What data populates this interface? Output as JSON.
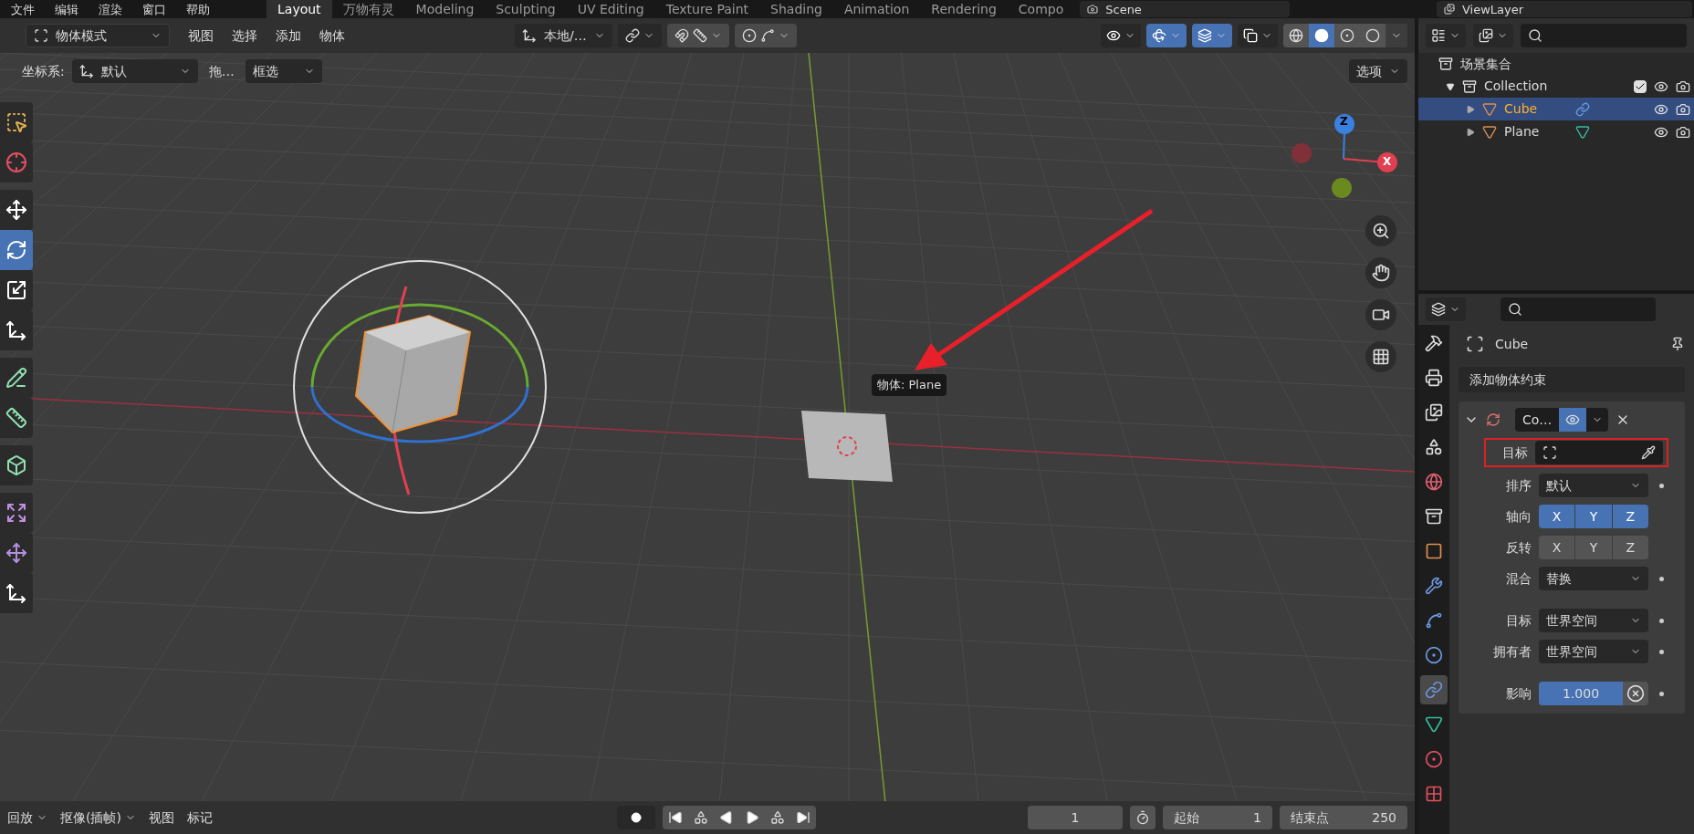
{
  "top_menu": [
    "文件",
    "编辑",
    "渲染",
    "窗口",
    "帮助"
  ],
  "workspace_tabs": [
    {
      "label": "Layout",
      "selected": true
    },
    {
      "label": "万物有灵",
      "selected": false
    },
    {
      "label": "Modeling",
      "selected": false
    },
    {
      "label": "Sculpting",
      "selected": false
    },
    {
      "label": "UV Editing",
      "selected": false
    },
    {
      "label": "Texture Paint",
      "selected": false
    },
    {
      "label": "Shading",
      "selected": false
    },
    {
      "label": "Animation",
      "selected": false
    },
    {
      "label": "Rendering",
      "selected": false
    },
    {
      "label": "Compo",
      "selected": false
    }
  ],
  "scene": "Scene",
  "view_layer": "ViewLayer",
  "header": {
    "mode": "物体模式",
    "menus": [
      "视图",
      "选择",
      "添加",
      "物体"
    ],
    "transform_orientation": "本地/…",
    "toggles": [
      {
        "kind": "visibility",
        "on": false
      },
      {
        "kind": "gizmo",
        "on": true
      },
      {
        "kind": "overlay",
        "on": true
      },
      {
        "kind": "xray",
        "on": false
      }
    ],
    "shading": [
      {
        "kind": "wireframe",
        "selected": false
      },
      {
        "kind": "solid",
        "selected": true
      },
      {
        "kind": "material",
        "selected": false
      },
      {
        "kind": "rendered",
        "selected": false
      }
    ]
  },
  "tool_settings": {
    "coord_label": "坐标系:",
    "coord_value": "默认",
    "drag": "拖…",
    "select_mode": "框选",
    "options": "选项"
  },
  "toolbar": [
    {
      "tools": [
        {
          "kind": "select",
          "selected": false
        },
        {
          "kind": "cursor",
          "selected": false
        }
      ]
    },
    {
      "tools": [
        {
          "kind": "move",
          "selected": false
        },
        {
          "kind": "rotate",
          "selected": true
        },
        {
          "kind": "scale",
          "selected": false
        },
        {
          "kind": "transform",
          "selected": false
        }
      ]
    },
    {
      "tools": [
        {
          "kind": "annotate",
          "selected": false
        },
        {
          "kind": "measure",
          "selected": false
        }
      ]
    },
    {
      "tools": [
        {
          "kind": "add_cube",
          "selected": false
        }
      ]
    },
    {
      "tools": [
        {
          "kind": "cage",
          "selected": false
        },
        {
          "kind": "shear",
          "selected": false
        },
        {
          "kind": "transform",
          "selected": false
        }
      ]
    }
  ],
  "viewport": {
    "tooltip": "物体: Plane",
    "axis_z": "Z",
    "axis_x": "X"
  },
  "outliner": {
    "root": "场景集合",
    "tree": [
      {
        "label": "Collection",
        "expanded": true,
        "checked": true,
        "selected": false,
        "children": [
          {
            "label": "Cube",
            "expanded": false,
            "selected": true,
            "kind": "constraint"
          },
          {
            "label": "Plane",
            "expanded": false,
            "selected": false,
            "kind": "mesh"
          }
        ]
      }
    ]
  },
  "properties": {
    "tabs": [
      {
        "kind": "tool",
        "selected": false
      },
      {
        "kind": "output",
        "selected": false
      },
      {
        "kind": "view_layer",
        "selected": false
      },
      {
        "kind": "scene",
        "selected": false
      },
      {
        "kind": "world",
        "selected": false
      },
      {
        "kind": "collection",
        "selected": false
      },
      {
        "kind": "object",
        "selected": false
      },
      {
        "kind": "modifier",
        "selected": false
      },
      {
        "kind": "particles",
        "selected": false
      },
      {
        "kind": "physics",
        "selected": false
      },
      {
        "kind": "constraint",
        "selected": true
      },
      {
        "kind": "data",
        "selected": false
      },
      {
        "kind": "material",
        "selected": false
      },
      {
        "kind": "texture",
        "selected": false
      }
    ],
    "object_name": "Cube",
    "add_constraint": "添加物体约束",
    "constraint": {
      "name": "Co…",
      "expanded": true,
      "enabled": true,
      "rows": [
        {
          "kind": "target",
          "label": "目标",
          "highlighted": true
        },
        {
          "kind": "dropdown",
          "label": "排序",
          "value": "默认"
        },
        {
          "kind": "toggles",
          "label": "轴向",
          "options": [
            {
              "label": "X",
              "on": true
            },
            {
              "label": "Y",
              "on": true
            },
            {
              "label": "Z",
              "on": true
            }
          ]
        },
        {
          "kind": "toggles",
          "label": "反转",
          "options": [
            {
              "label": "X",
              "on": false
            },
            {
              "label": "Y",
              "on": false
            },
            {
              "label": "Z",
              "on": false
            }
          ]
        },
        {
          "kind": "dropdown",
          "label": "混合",
          "value": "替换"
        },
        {
          "kind": "spacer"
        },
        {
          "kind": "dropdown",
          "label": "目标",
          "value": "世界空间"
        },
        {
          "kind": "dropdown",
          "label": "拥有者",
          "value": "世界空间"
        },
        {
          "kind": "spacer"
        },
        {
          "kind": "slider",
          "label": "影响",
          "value": "1.000",
          "level": 1
        }
      ]
    }
  },
  "timeline": {
    "menus": [
      "回放",
      "抠像(插帧)",
      "视图",
      "标记"
    ],
    "current_frame": "1",
    "start_label": "起始",
    "start": "1",
    "end_label": "结束点",
    "end": "250"
  }
}
